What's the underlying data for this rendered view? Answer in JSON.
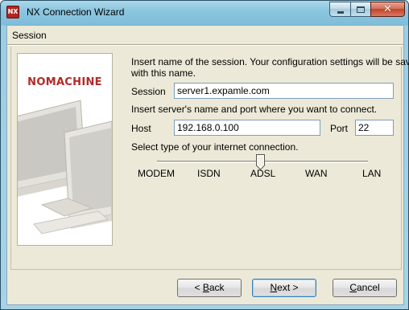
{
  "window": {
    "title": "NX Connection Wizard",
    "app_icon_text": "NX",
    "accent": "#b22a27"
  },
  "section": {
    "title": "Session"
  },
  "banner": {
    "logo": "NOMACHINE"
  },
  "form": {
    "intro_line1": "Insert name of the session. Your configuration settings will be saved",
    "intro_line2": "with this name.",
    "session_label": "Session",
    "session_value": "server1.expamle.com",
    "server_prompt": "Insert server's name and port where you want to connect.",
    "host_label": "Host",
    "host_value": "192.168.0.100",
    "port_label": "Port",
    "port_value": "22",
    "connection_prompt": "Select type of your internet connection."
  },
  "connection_slider": {
    "labels": [
      "MODEM",
      "ISDN",
      "ADSL",
      "WAN",
      "LAN"
    ],
    "selected": "ADSL",
    "selected_index": 2
  },
  "buttons": {
    "back_prefix": "< ",
    "back_mnemonic": "B",
    "back_rest": "ack",
    "next_mnemonic": "N",
    "next_rest": "ext >",
    "cancel_mnemonic": "C",
    "cancel_rest": "ancel"
  },
  "icons": {
    "minimize": "minimize-icon",
    "maximize": "maximize-icon",
    "close": "close-icon"
  }
}
